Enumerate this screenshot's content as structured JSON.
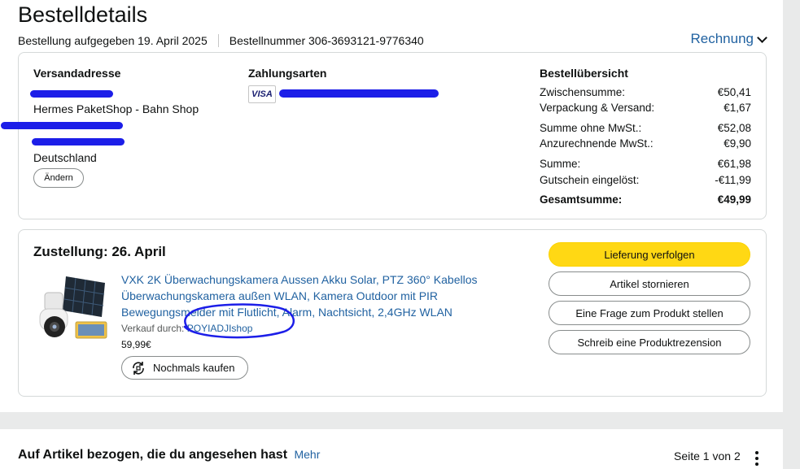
{
  "header": {
    "title": "Bestelldetails",
    "order_placed": "Bestellung aufgegeben 19. April 2025",
    "order_number": "Bestellnummer 306-3693121-9776340",
    "invoice_label": "Rechnung"
  },
  "shipping": {
    "heading": "Versandadresse",
    "line2": "Hermes PaketShop - Bahn Shop",
    "country": "Deutschland",
    "change_label": "Ändern"
  },
  "payment": {
    "heading": "Zahlungsarten",
    "card_brand": "VISA"
  },
  "summary": {
    "heading": "Bestellübersicht",
    "rows": [
      {
        "label": "Zwischensumme:",
        "value": "€50,41"
      },
      {
        "label": "Verpackung & Versand:",
        "value": "€1,67"
      },
      {
        "label": "Summe ohne MwSt.:",
        "value": "€52,08"
      },
      {
        "label": "Anzurechnende MwSt.:",
        "value": "€9,90"
      },
      {
        "label": "Summe:",
        "value": "€61,98"
      },
      {
        "label": "Gutschein eingelöst:",
        "value": "-€11,99"
      },
      {
        "label": "Gesamtsumme:",
        "value": "€49,99"
      }
    ]
  },
  "delivery": {
    "heading": "Zustellung: 26. April",
    "product_title": "VXK 2K Überwachungskamera Aussen Akku Solar, PTZ 360° Kabellos Überwachungskamera außen WLAN, Kamera Outdoor mit PIR Bewegungsmelder mit Flutlicht, Alarm, Nachtsicht, 2,4GHz WLAN",
    "sold_by_label": "Verkauf durch:",
    "seller": "POYIADJIshop",
    "price": "59,99€",
    "buy_again_label": "Nochmals kaufen"
  },
  "actions": {
    "track": "Lieferung verfolgen",
    "cancel": "Artikel stornieren",
    "question": "Eine Frage zum Produkt stellen",
    "review": "Schreib eine Produktrezension"
  },
  "related": {
    "heading": "Auf Artikel bezogen, die du angesehen hast",
    "more": "Mehr",
    "pager": "Seite 1 von 2"
  },
  "colors": {
    "link": "#2162a1",
    "primary_button": "#ffd814",
    "redaction_ink": "#1c1ee8"
  }
}
